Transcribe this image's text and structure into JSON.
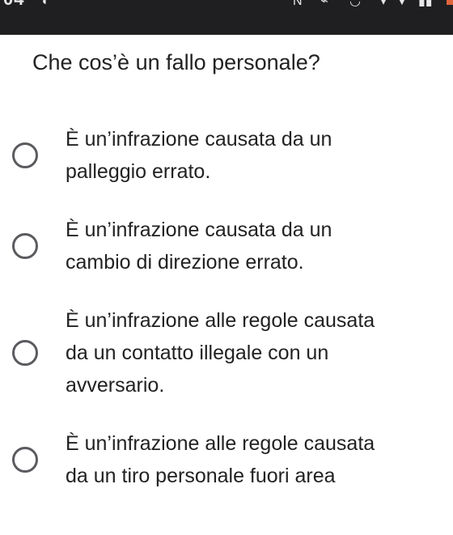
{
  "status_bar": {
    "clock": "04",
    "icons": [
      "nfc-icon",
      "vibrate-icon",
      "alarm-icon",
      "wifi-icon",
      "signal-icon",
      "battery-icon"
    ]
  },
  "question": "Che cos’è un fallo personale?",
  "options": [
    {
      "lines": [
        "È un’infrazione causata da un",
        "palleggio errato."
      ]
    },
    {
      "lines": [
        "È un’infrazione causata da un",
        "cambio di direzione errato."
      ]
    },
    {
      "lines": [
        "È un’infrazione alle regole causata",
        "da un contatto illegale con un",
        "avversario."
      ]
    },
    {
      "lines": [
        "È un’infrazione alle regole causata",
        "da un tiro personale fuori area"
      ]
    }
  ],
  "colors": {
    "status_bar_bg": "#1f1f22",
    "text": "#222222",
    "radio_border": "#5b5b5f",
    "battery_accent": "#e0643c"
  }
}
